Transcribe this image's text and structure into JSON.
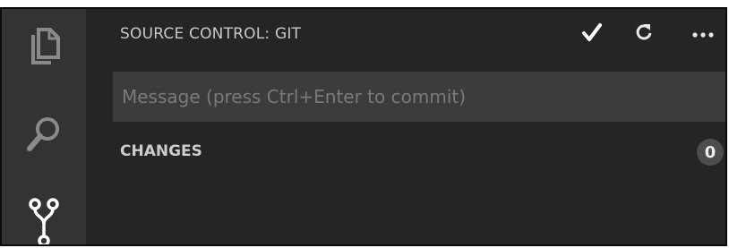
{
  "activity_bar": {
    "items": [
      {
        "icon": "files-icon",
        "active": false
      },
      {
        "icon": "search-icon",
        "active": false
      },
      {
        "icon": "source-control-icon",
        "active": true
      }
    ]
  },
  "header": {
    "title": "SOURCE CONTROL: GIT",
    "actions": [
      {
        "icon": "checkmark-icon"
      },
      {
        "icon": "refresh-icon"
      },
      {
        "icon": "more-icon"
      }
    ]
  },
  "commit": {
    "placeholder": "Message (press Ctrl+Enter to commit)",
    "value": ""
  },
  "changes": {
    "label": "CHANGES",
    "count": "0"
  },
  "colors": {
    "activity_bar_bg": "#333333",
    "sidebar_bg": "#252526",
    "input_bg": "#3c3c3c",
    "badge_bg": "#4d4d4d",
    "icon_inactive": "#8a8a8a",
    "icon_active": "#ffffff"
  }
}
